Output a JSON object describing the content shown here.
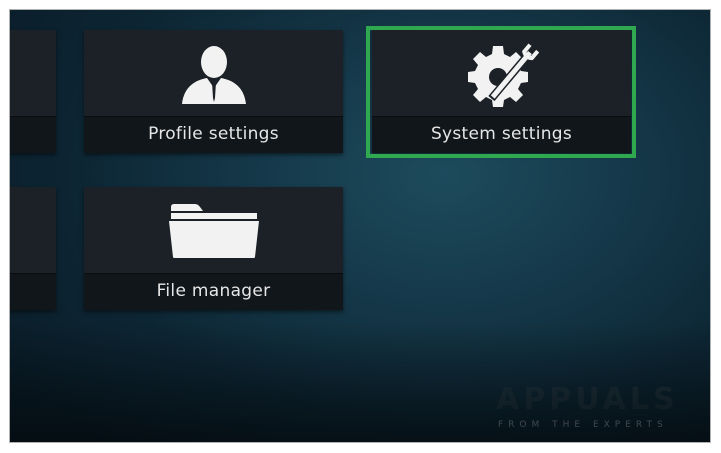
{
  "tiles": [
    {
      "id": "profile",
      "label": "Profile settings",
      "icon": "user-icon"
    },
    {
      "id": "system",
      "label": "System settings",
      "icon": "gear-wrench-icon"
    },
    {
      "id": "file",
      "label": "File manager",
      "icon": "folder-icon"
    }
  ],
  "profile": {
    "label": "Profile settings"
  },
  "system": {
    "label": "System settings"
  },
  "file": {
    "label": "File manager"
  },
  "watermark": {
    "text": "APPUALS",
    "sub": "FROM THE EXPERTS"
  },
  "colors": {
    "highlight": "#2fa84f",
    "tile_bg": "#1b2126",
    "label_band": "#11161a",
    "background": "#15394a"
  }
}
